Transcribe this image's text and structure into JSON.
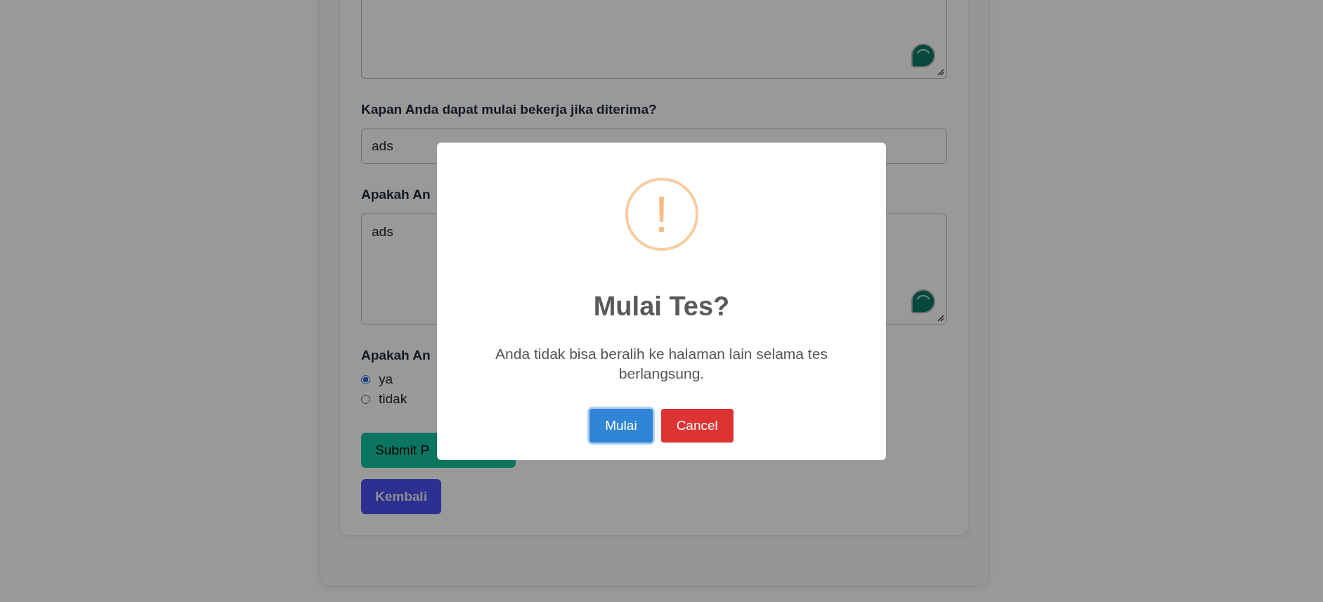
{
  "form": {
    "fields": [
      {
        "kind": "textarea",
        "assistant": true
      },
      {
        "kind": "input",
        "label": "Kapan Anda dapat mulai bekerja jika diterima?",
        "value": "ads"
      },
      {
        "kind": "textarea",
        "label": "Apakah An",
        "value": "ads",
        "assistant": true
      },
      {
        "kind": "radio",
        "label": "Apakah An",
        "options": [
          {
            "label": "ya",
            "selected": true
          },
          {
            "label": "tidak",
            "selected": false
          }
        ]
      }
    ],
    "buttons": [
      {
        "kind": "submit",
        "label": "Submit P"
      },
      {
        "kind": "back",
        "label": "Kembali"
      }
    ]
  },
  "dialog": {
    "icon": "!",
    "title": "Mulai Tes?",
    "message": "Anda tidak bisa beralih ke halaman lain selama tes berlangsung.",
    "buttons": [
      {
        "kind": "confirm",
        "label": "Mulai",
        "focused": true
      },
      {
        "kind": "cancel",
        "label": "Cancel",
        "focused": false
      }
    ]
  }
}
